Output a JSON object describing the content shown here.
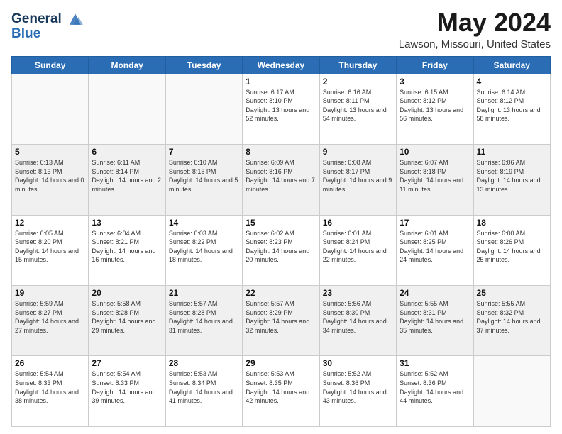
{
  "header": {
    "logo_line1": "General",
    "logo_line2": "Blue",
    "month": "May 2024",
    "location": "Lawson, Missouri, United States"
  },
  "days_of_week": [
    "Sunday",
    "Monday",
    "Tuesday",
    "Wednesday",
    "Thursday",
    "Friday",
    "Saturday"
  ],
  "weeks": [
    [
      {
        "day": "",
        "info": ""
      },
      {
        "day": "",
        "info": ""
      },
      {
        "day": "",
        "info": ""
      },
      {
        "day": "1",
        "info": "Sunrise: 6:17 AM\nSunset: 8:10 PM\nDaylight: 13 hours and 52 minutes."
      },
      {
        "day": "2",
        "info": "Sunrise: 6:16 AM\nSunset: 8:11 PM\nDaylight: 13 hours and 54 minutes."
      },
      {
        "day": "3",
        "info": "Sunrise: 6:15 AM\nSunset: 8:12 PM\nDaylight: 13 hours and 56 minutes."
      },
      {
        "day": "4",
        "info": "Sunrise: 6:14 AM\nSunset: 8:12 PM\nDaylight: 13 hours and 58 minutes."
      }
    ],
    [
      {
        "day": "5",
        "info": "Sunrise: 6:13 AM\nSunset: 8:13 PM\nDaylight: 14 hours and 0 minutes."
      },
      {
        "day": "6",
        "info": "Sunrise: 6:11 AM\nSunset: 8:14 PM\nDaylight: 14 hours and 2 minutes."
      },
      {
        "day": "7",
        "info": "Sunrise: 6:10 AM\nSunset: 8:15 PM\nDaylight: 14 hours and 5 minutes."
      },
      {
        "day": "8",
        "info": "Sunrise: 6:09 AM\nSunset: 8:16 PM\nDaylight: 14 hours and 7 minutes."
      },
      {
        "day": "9",
        "info": "Sunrise: 6:08 AM\nSunset: 8:17 PM\nDaylight: 14 hours and 9 minutes."
      },
      {
        "day": "10",
        "info": "Sunrise: 6:07 AM\nSunset: 8:18 PM\nDaylight: 14 hours and 11 minutes."
      },
      {
        "day": "11",
        "info": "Sunrise: 6:06 AM\nSunset: 8:19 PM\nDaylight: 14 hours and 13 minutes."
      }
    ],
    [
      {
        "day": "12",
        "info": "Sunrise: 6:05 AM\nSunset: 8:20 PM\nDaylight: 14 hours and 15 minutes."
      },
      {
        "day": "13",
        "info": "Sunrise: 6:04 AM\nSunset: 8:21 PM\nDaylight: 14 hours and 16 minutes."
      },
      {
        "day": "14",
        "info": "Sunrise: 6:03 AM\nSunset: 8:22 PM\nDaylight: 14 hours and 18 minutes."
      },
      {
        "day": "15",
        "info": "Sunrise: 6:02 AM\nSunset: 8:23 PM\nDaylight: 14 hours and 20 minutes."
      },
      {
        "day": "16",
        "info": "Sunrise: 6:01 AM\nSunset: 8:24 PM\nDaylight: 14 hours and 22 minutes."
      },
      {
        "day": "17",
        "info": "Sunrise: 6:01 AM\nSunset: 8:25 PM\nDaylight: 14 hours and 24 minutes."
      },
      {
        "day": "18",
        "info": "Sunrise: 6:00 AM\nSunset: 8:26 PM\nDaylight: 14 hours and 25 minutes."
      }
    ],
    [
      {
        "day": "19",
        "info": "Sunrise: 5:59 AM\nSunset: 8:27 PM\nDaylight: 14 hours and 27 minutes."
      },
      {
        "day": "20",
        "info": "Sunrise: 5:58 AM\nSunset: 8:28 PM\nDaylight: 14 hours and 29 minutes."
      },
      {
        "day": "21",
        "info": "Sunrise: 5:57 AM\nSunset: 8:28 PM\nDaylight: 14 hours and 31 minutes."
      },
      {
        "day": "22",
        "info": "Sunrise: 5:57 AM\nSunset: 8:29 PM\nDaylight: 14 hours and 32 minutes."
      },
      {
        "day": "23",
        "info": "Sunrise: 5:56 AM\nSunset: 8:30 PM\nDaylight: 14 hours and 34 minutes."
      },
      {
        "day": "24",
        "info": "Sunrise: 5:55 AM\nSunset: 8:31 PM\nDaylight: 14 hours and 35 minutes."
      },
      {
        "day": "25",
        "info": "Sunrise: 5:55 AM\nSunset: 8:32 PM\nDaylight: 14 hours and 37 minutes."
      }
    ],
    [
      {
        "day": "26",
        "info": "Sunrise: 5:54 AM\nSunset: 8:33 PM\nDaylight: 14 hours and 38 minutes."
      },
      {
        "day": "27",
        "info": "Sunrise: 5:54 AM\nSunset: 8:33 PM\nDaylight: 14 hours and 39 minutes."
      },
      {
        "day": "28",
        "info": "Sunrise: 5:53 AM\nSunset: 8:34 PM\nDaylight: 14 hours and 41 minutes."
      },
      {
        "day": "29",
        "info": "Sunrise: 5:53 AM\nSunset: 8:35 PM\nDaylight: 14 hours and 42 minutes."
      },
      {
        "day": "30",
        "info": "Sunrise: 5:52 AM\nSunset: 8:36 PM\nDaylight: 14 hours and 43 minutes."
      },
      {
        "day": "31",
        "info": "Sunrise: 5:52 AM\nSunset: 8:36 PM\nDaylight: 14 hours and 44 minutes."
      },
      {
        "day": "",
        "info": ""
      }
    ]
  ]
}
